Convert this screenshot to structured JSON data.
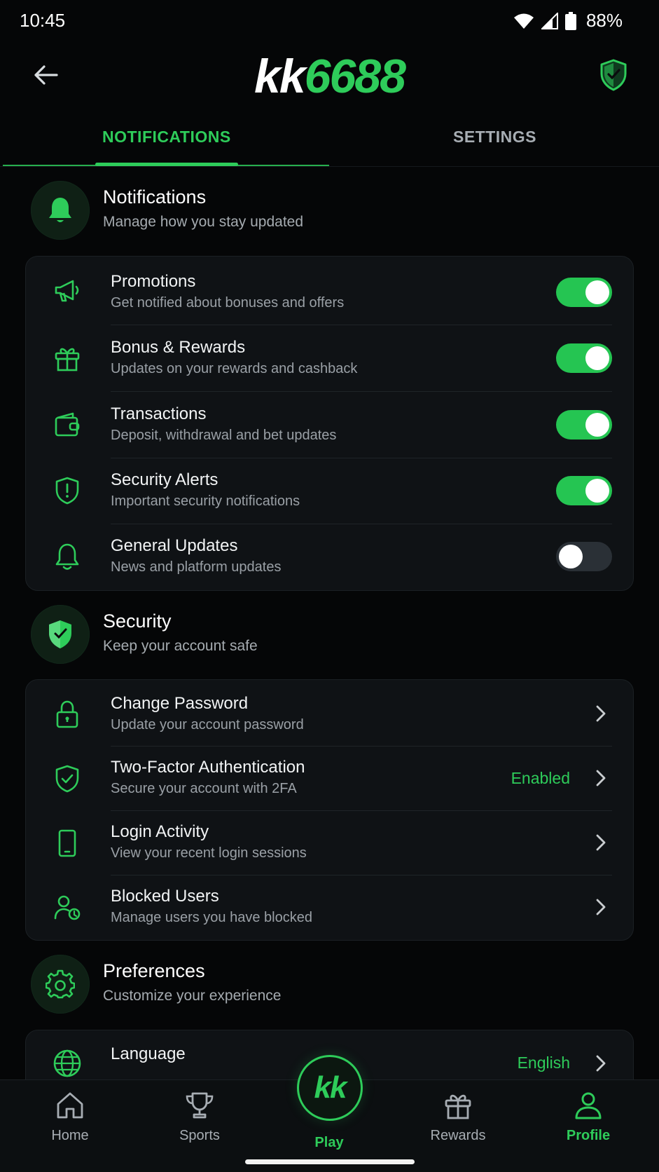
{
  "status_bar": {
    "time": "10:45",
    "battery": "88%"
  },
  "header": {
    "logo_part1": "kk",
    "logo_part2": "6688"
  },
  "tabs": [
    {
      "label": "NOTIFICATIONS",
      "active": true
    },
    {
      "label": "SETTINGS",
      "active": false
    }
  ],
  "notifications_section": {
    "title": "Notifications",
    "subtitle": "Manage how you stay updated",
    "items": [
      {
        "title": "Promotions",
        "subtitle": "Get notified about bonuses and offers",
        "icon": "megaphone-icon",
        "enabled": true
      },
      {
        "title": "Bonus & Rewards",
        "subtitle": "Updates on your rewards and cashback",
        "icon": "gift-icon",
        "enabled": true
      },
      {
        "title": "Transactions",
        "subtitle": "Deposit, withdrawal and bet updates",
        "icon": "wallet-icon",
        "enabled": true
      },
      {
        "title": "Security Alerts",
        "subtitle": "Important security notifications",
        "icon": "shield-alert-icon",
        "enabled": true
      },
      {
        "title": "General Updates",
        "subtitle": "News and platform updates",
        "icon": "bell-icon",
        "enabled": false
      }
    ]
  },
  "security_section": {
    "title": "Security",
    "subtitle": "Keep your account safe",
    "items": [
      {
        "title": "Change Password",
        "subtitle": "Update your account password",
        "icon": "lock-icon",
        "value": ""
      },
      {
        "title": "Two-Factor Authentication",
        "subtitle": "Secure your account with 2FA",
        "icon": "shield-check-icon",
        "value": "Enabled"
      },
      {
        "title": "Login Activity",
        "subtitle": "View your recent login sessions",
        "icon": "phone-icon",
        "value": ""
      },
      {
        "title": "Blocked Users",
        "subtitle": "Manage users you have blocked",
        "icon": "users-blocked-icon",
        "value": ""
      }
    ]
  },
  "preferences_section": {
    "title": "Preferences",
    "subtitle": "Customize your experience",
    "items": [
      {
        "title": "Language",
        "icon": "globe-icon",
        "value": "English"
      }
    ]
  },
  "bottom_nav": {
    "items": [
      {
        "label": "Home",
        "icon": "home-icon",
        "active": false
      },
      {
        "label": "Sports",
        "icon": "trophy-icon",
        "active": false
      },
      {
        "label": "Play",
        "icon": "kk-play-icon",
        "badge": "kk",
        "active": false
      },
      {
        "label": "Rewards",
        "icon": "gift-icon",
        "active": false
      },
      {
        "label": "Profile",
        "icon": "user-icon",
        "active": true
      }
    ]
  },
  "colors": {
    "accent": "#2ecc5a",
    "background": "#050607",
    "card": "#0f1215",
    "toggle_off": "#2a3036"
  }
}
